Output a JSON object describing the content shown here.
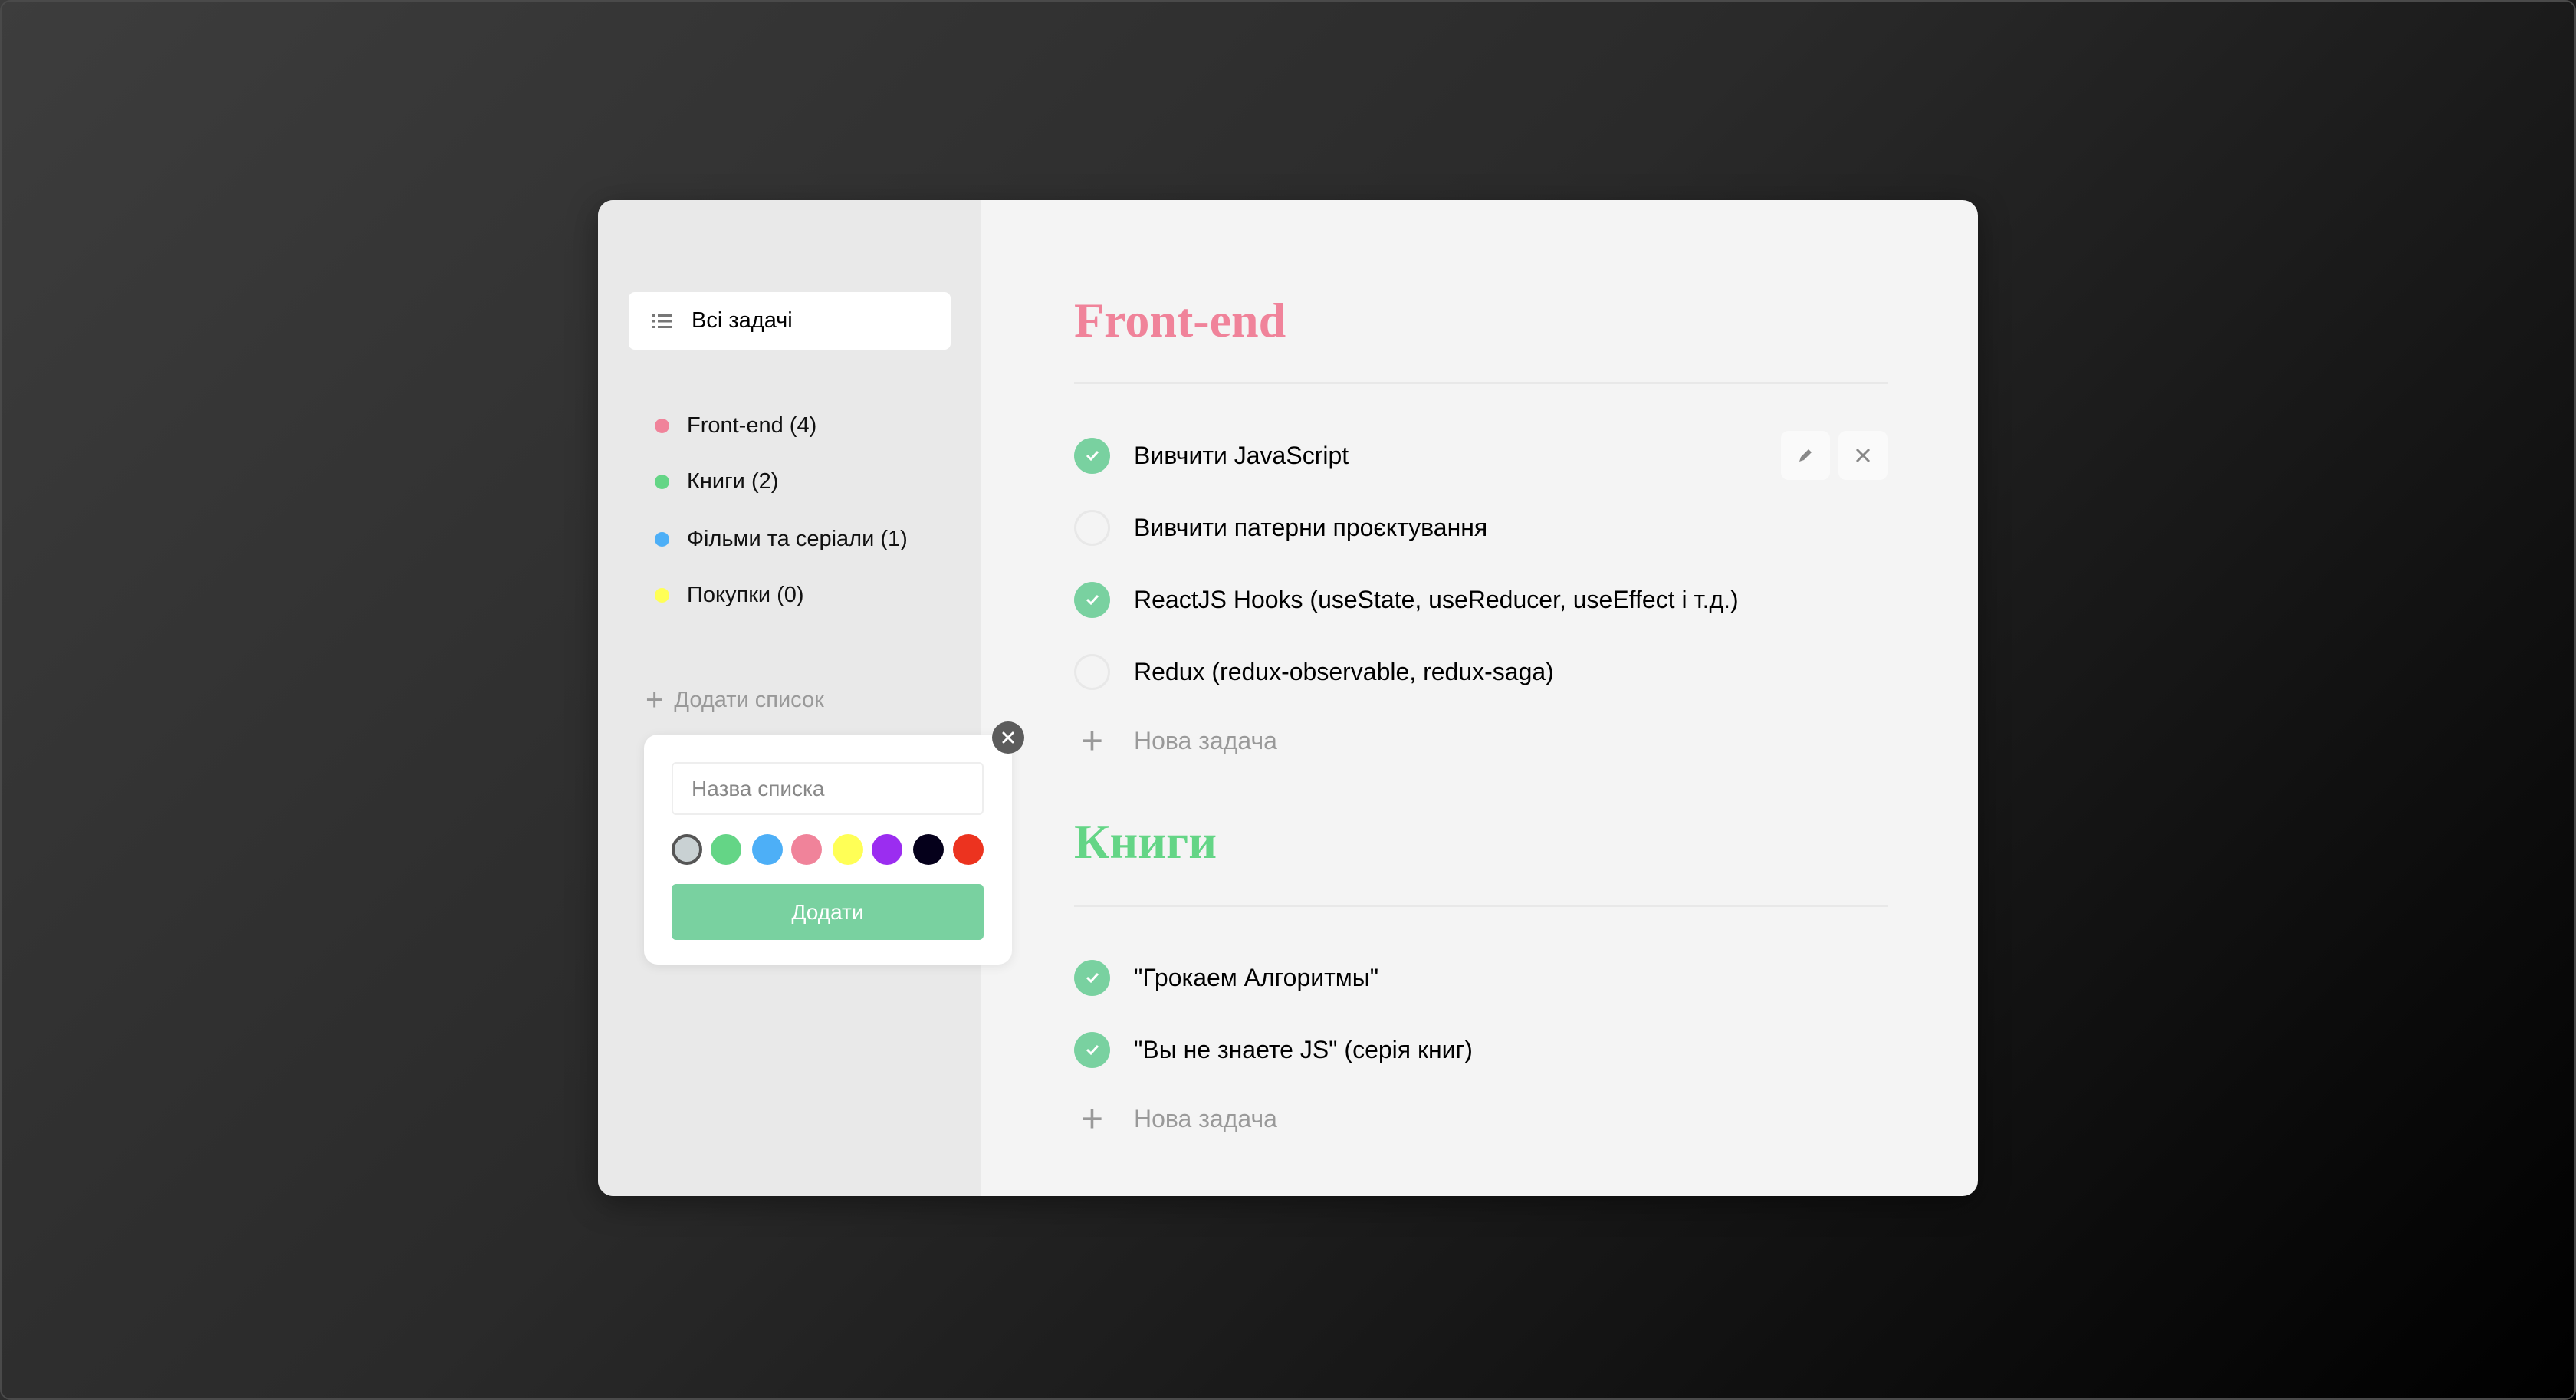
{
  "sidebar": {
    "all_tasks_label": "Всі задачі",
    "lists": [
      {
        "label": "Front-end (4)",
        "color": "#f0839a"
      },
      {
        "label": "Книги (2)",
        "color": "#64d586"
      },
      {
        "label": "Фільми та серіали (1)",
        "color": "#4daff7"
      },
      {
        "label": "Покупки (0)",
        "color": "#ffff56"
      }
    ],
    "add_list_label": "Додати список",
    "popup": {
      "input_placeholder": "Назва списка",
      "input_value": "",
      "colors": [
        "#c9d1d3",
        "#64d586",
        "#4daff7",
        "#f0839a",
        "#ffff56",
        "#9b2df0",
        "#05001b",
        "#ec331f"
      ],
      "selected_color_index": 0,
      "submit_label": "Додати"
    }
  },
  "main": {
    "sections": [
      {
        "title": "Front-end",
        "color": "#f0839a",
        "tasks": [
          {
            "text": "Вивчити JavaScript",
            "done": true
          },
          {
            "text": "Вивчити патерни проєктування",
            "done": false
          },
          {
            "text": "ReactJS Hooks (useState, useReducer, useEffect і т.д.)",
            "done": true
          },
          {
            "text": "Redux (redux-observable, redux-saga)",
            "done": false
          }
        ],
        "new_task_label": "Нова задача"
      },
      {
        "title": "Книги",
        "color": "#64d586",
        "tasks": [
          {
            "text": "\"Грокаем Алгоритмы\"",
            "done": true
          },
          {
            "text": "\"Вы не знаете JS\" (серія книг)",
            "done": true
          }
        ],
        "new_task_label": "Нова задача"
      }
    ]
  }
}
